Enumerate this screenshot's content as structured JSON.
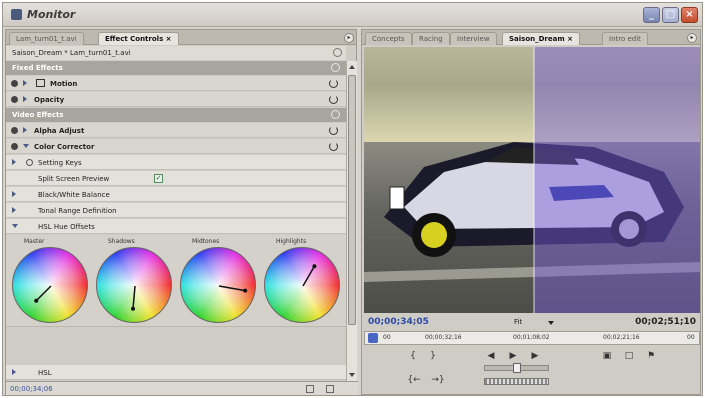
{
  "window": {
    "title": "Monitor"
  },
  "left_tabs": [
    {
      "label": "Lam_turn01_t.avi"
    },
    {
      "label": "Effect Controls ×"
    }
  ],
  "clip_header": "Saison_Dream * Lam_turn01_t.avi",
  "sections": {
    "fixed": "Fixed Effects",
    "video": "Video Effects"
  },
  "fixed_effects": [
    {
      "label": "Motion"
    },
    {
      "label": "Opacity"
    }
  ],
  "video_effects": [
    {
      "label": "Alpha Adjust"
    },
    {
      "label": "Color Corrector"
    }
  ],
  "color_corrector_rows": [
    {
      "label": "Setting Keys"
    },
    {
      "label": "Split Screen Preview"
    },
    {
      "label": "Black/White Balance"
    },
    {
      "label": "Tonal Range Definition"
    },
    {
      "label": "HSL Hue Offsets"
    }
  ],
  "wheels": [
    {
      "label": "Master",
      "angle_deg": 135,
      "length": 0.55
    },
    {
      "label": "Shadows",
      "angle_deg": 95,
      "length": 0.6
    },
    {
      "label": "Midtones",
      "angle_deg": 10,
      "length": 0.7
    },
    {
      "label": "Highlights",
      "angle_deg": 300,
      "length": 0.6
    }
  ],
  "hsl_row": "HSL",
  "left_timecode": "00;00;34;06",
  "right_tabs": [
    {
      "label": "Concepts"
    },
    {
      "label": "Racing"
    },
    {
      "label": "Interview"
    },
    {
      "label": "Saison_Dream ×"
    },
    {
      "label": "Intro edit"
    }
  ],
  "monitor": {
    "current_timecode": "00;00;34;05",
    "fit_label": "Fit",
    "duration_timecode": "00;02;51;10"
  },
  "ruler_ticks": [
    "00",
    "00;00;32;16",
    "00;01;08;02",
    "00;02;21;16",
    "00"
  ],
  "transport_glyphs": {
    "mark_in": "{",
    "mark_out": "}",
    "step_back": "◀",
    "play": "▶",
    "step_fwd": "▶",
    "go_in": "{←",
    "go_out": "→}",
    "camera": "▣",
    "safe": "□",
    "export": "⚑"
  }
}
